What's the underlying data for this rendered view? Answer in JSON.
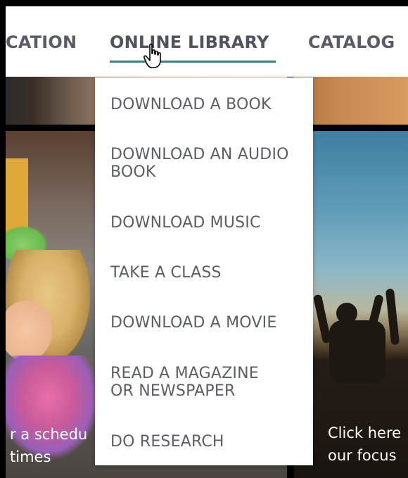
{
  "nav": {
    "items": [
      "CATION",
      "ONLINE LIBRARY",
      "CATALOG"
    ]
  },
  "dropdown": {
    "items": [
      [
        "DOWNLOAD A BOOK"
      ],
      [
        "DOWNLOAD AN AUDIO",
        "BOOK"
      ],
      [
        "DOWNLOAD MUSIC"
      ],
      [
        "TAKE A CLASS"
      ],
      [
        "DOWNLOAD A MOVIE"
      ],
      [
        "READ A MAGAZINE",
        "OR NEWSPAPER"
      ],
      [
        "DO RESEARCH"
      ]
    ]
  },
  "captions": {
    "left": [
      "r a schedu",
      "times"
    ],
    "right": [
      "Click here",
      "our focus"
    ]
  },
  "colors": {
    "nav_text": "#595c66",
    "nav_underline": "#3b8079",
    "menu_text": "#5c5e66"
  }
}
